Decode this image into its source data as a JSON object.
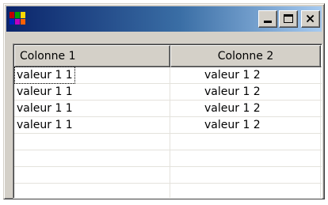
{
  "window": {
    "app_icon": "multicolor-window-icon",
    "buttons": {
      "minimize_icon": "minimize-icon",
      "maximize_icon": "maximize-icon",
      "close_icon": "close-icon"
    },
    "colors": {
      "title_start": "#0a246a",
      "title_end": "#a6caf0",
      "face": "#d4d0c8"
    }
  },
  "list": {
    "columns": [
      "Colonne 1",
      "Colonne 2"
    ],
    "rows": [
      [
        "valeur 1 1",
        "valeur 1 2"
      ],
      [
        "valeur 1 1",
        "valeur 1 2"
      ],
      [
        "valeur 1 1",
        "valeur 1 2"
      ],
      [
        "valeur 1 1",
        "valeur 1 2"
      ]
    ]
  }
}
